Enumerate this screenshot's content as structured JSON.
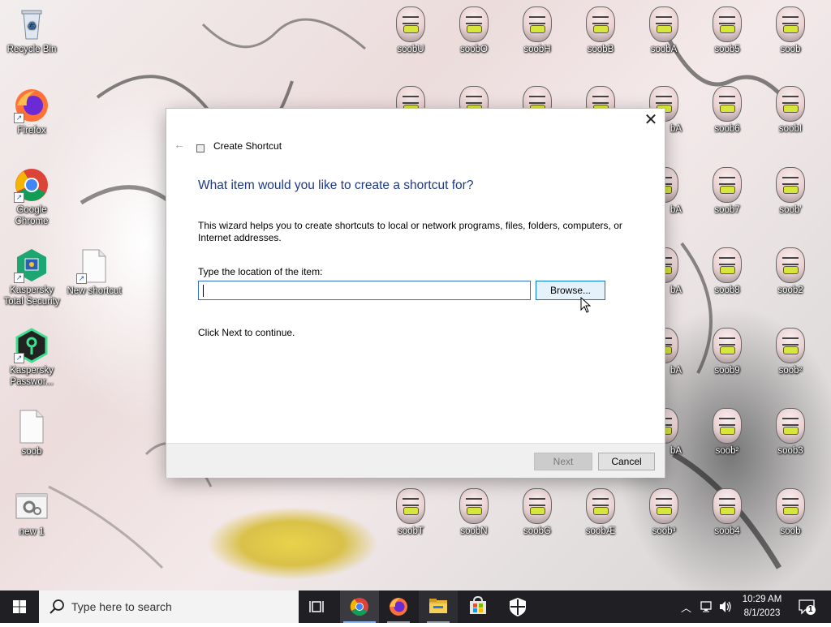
{
  "desktop": {
    "left_icons": [
      {
        "label": "Recycle Bin",
        "icon": "recycle-bin-icon"
      },
      {
        "label": "Firefox",
        "icon": "firefox-icon"
      },
      {
        "label": "Google Chrome",
        "icon": "chrome-icon"
      },
      {
        "label": "Kaspersky Total Security",
        "icon": "kaspersky-total-security-icon"
      },
      {
        "label": "Kaspersky Passwor...",
        "icon": "kaspersky-password-icon"
      },
      {
        "label": "soob",
        "icon": "blank-file-icon"
      },
      {
        "label": "new 1",
        "icon": "settings-file-icon"
      }
    ],
    "new_shortcut": {
      "label": "New shortcut",
      "icon": "blank-file-icon"
    },
    "soob_top_row": [
      "soobU",
      "soobO",
      "soobH",
      "soobB",
      "soobA",
      "soob5",
      "soob"
    ],
    "soob_right_col_a": [
      "bA",
      "bA",
      "bA",
      "bA",
      "bA"
    ],
    "soob_right_col_b": [
      "soob6",
      "soob7",
      "soob8",
      "soob9",
      "soob²"
    ],
    "soob_right_col_c": [
      "soobI",
      "soob'",
      "soob2",
      "soob²",
      "soob3"
    ],
    "soob_bottom_row": [
      "soobT",
      "soobN",
      "soobG",
      "soobÆ",
      "soob³",
      "soob4",
      "soob"
    ]
  },
  "dialog": {
    "title": "Create Shortcut",
    "heading": "What item would you like to create a shortcut for?",
    "description": "This wizard helps you to create shortcuts to local or network programs, files, folders, computers, or Internet addresses.",
    "location_label": "Type the location of the item:",
    "location_value": "",
    "browse_label": "Browse...",
    "click_next_text": "Click Next to continue.",
    "next_label": "Next",
    "cancel_label": "Cancel",
    "close_glyph": "✕",
    "back_glyph": "←"
  },
  "taskbar": {
    "search_placeholder": "Type here to search",
    "apps": [
      "task-view-icon",
      "chrome-icon",
      "firefox-icon",
      "file-explorer-icon",
      "microsoft-store-icon",
      "windows-security-icon"
    ],
    "time": "10:29 AM",
    "date": "8/1/2023",
    "notification_count": "1"
  },
  "colors": {
    "accent": "#0078d7",
    "heading": "#1e3a87",
    "taskbar_bg": "#1f1f24"
  }
}
